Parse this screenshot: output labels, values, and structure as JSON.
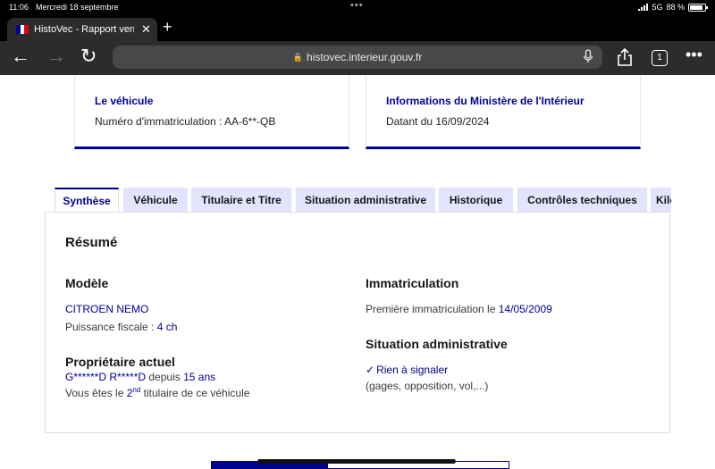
{
  "status_bar": {
    "time": "11:06",
    "date": "Mercredi 18 septembre",
    "network": "5G",
    "battery": "88 %",
    "battery_level": 0.88
  },
  "browser": {
    "tab_title": "HistoVec - Rapport vendeur",
    "url": "histovec.interieur.gouv.fr",
    "tab_count": "1"
  },
  "cards": [
    {
      "heading": "Le véhicule",
      "value": "Numéro d'immatriculation : AA-6**-QB"
    },
    {
      "heading": "Informations du Ministère de l'Intérieur",
      "value": "Datant du 16/09/2024"
    }
  ],
  "page_tabs": [
    "Synthèse",
    "Véhicule",
    "Titulaire et Titre",
    "Situation administrative",
    "Historique",
    "Contrôles techniques",
    "Kilométrage"
  ],
  "summary": {
    "title": "Résumé",
    "modele": {
      "heading": "Modèle",
      "name": "CITROEN NEMO",
      "puissance_label": "Puissance fiscale :",
      "puissance_value": "4 ch"
    },
    "proprietaire": {
      "heading": "Propriétaire actuel",
      "name": "G******D R*****D",
      "depuis_label": "depuis",
      "depuis_value": "15 ans",
      "rank_prefix": "Vous êtes le",
      "rank_num": "2",
      "rank_sup": "nd",
      "rank_suffix": "titulaire de ce véhicule"
    },
    "immatriculation": {
      "heading": "Immatriculation",
      "label": "Première immatriculation le",
      "date": "14/05/2009"
    },
    "situation": {
      "heading": "Situation administrative",
      "status": "Rien à signaler",
      "detail": "(gages, opposition, vol,...)"
    }
  }
}
